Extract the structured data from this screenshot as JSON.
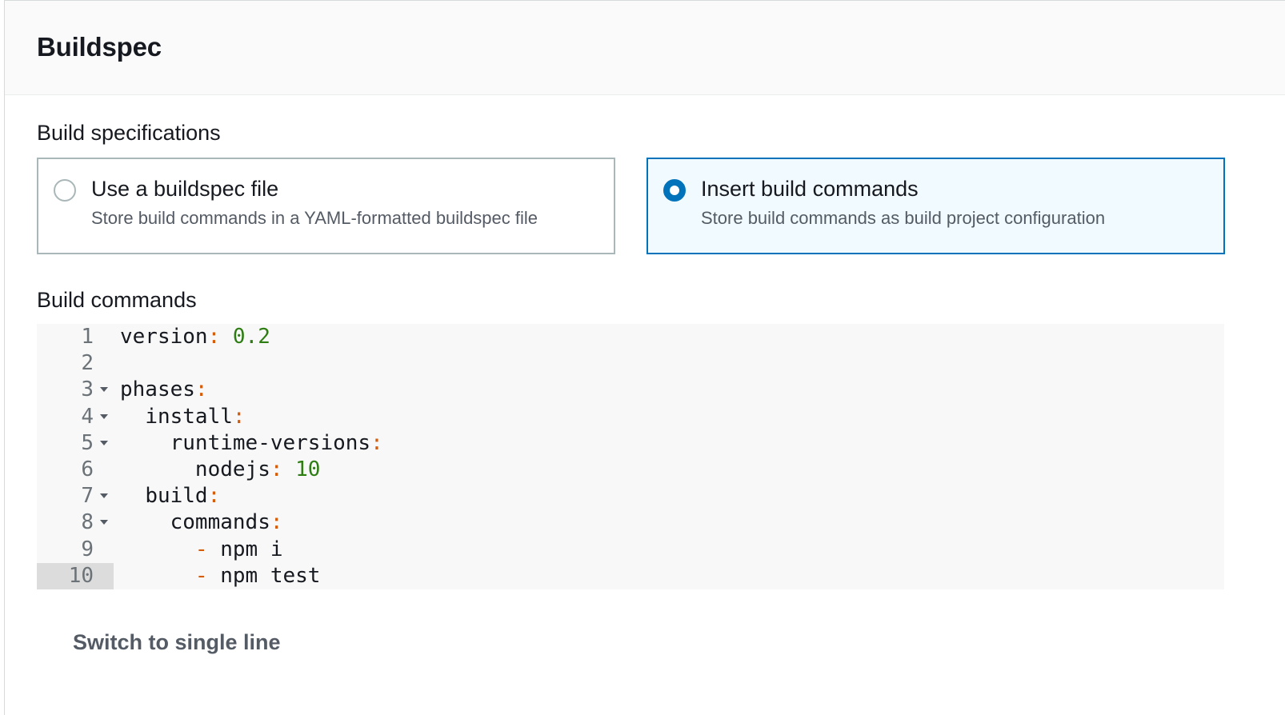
{
  "panel": {
    "title": "Buildspec"
  },
  "build_specifications": {
    "label": "Build specifications",
    "options": [
      {
        "title": "Use a buildspec file",
        "description": "Store build commands in a YAML-formatted buildspec file",
        "selected": false
      },
      {
        "title": "Insert build commands",
        "description": "Store build commands as build project configuration",
        "selected": true
      }
    ]
  },
  "build_commands": {
    "label": "Build commands",
    "lines": [
      {
        "num": "1",
        "indent": "",
        "key": "version",
        "colon": ":",
        "dash": "",
        "value": " 0.2",
        "value_kind": "num",
        "foldable": false
      },
      {
        "num": "2",
        "indent": "",
        "key": "",
        "colon": "",
        "dash": "",
        "value": "",
        "value_kind": "",
        "foldable": false
      },
      {
        "num": "3",
        "indent": "",
        "key": "phases",
        "colon": ":",
        "dash": "",
        "value": "",
        "value_kind": "",
        "foldable": true
      },
      {
        "num": "4",
        "indent": "  ",
        "key": "install",
        "colon": ":",
        "dash": "",
        "value": "",
        "value_kind": "",
        "foldable": true
      },
      {
        "num": "5",
        "indent": "    ",
        "key": "runtime-versions",
        "colon": ":",
        "dash": "",
        "value": "",
        "value_kind": "",
        "foldable": true
      },
      {
        "num": "6",
        "indent": "      ",
        "key": "nodejs",
        "colon": ":",
        "dash": "",
        "value": " 10",
        "value_kind": "num",
        "foldable": false
      },
      {
        "num": "7",
        "indent": "  ",
        "key": "build",
        "colon": ":",
        "dash": "",
        "value": "",
        "value_kind": "",
        "foldable": true
      },
      {
        "num": "8",
        "indent": "    ",
        "key": "commands",
        "colon": ":",
        "dash": "",
        "value": "",
        "value_kind": "",
        "foldable": true
      },
      {
        "num": "9",
        "indent": "      ",
        "key": "",
        "colon": "",
        "dash": "-",
        "value": " npm i",
        "value_kind": "text",
        "foldable": false
      },
      {
        "num": "10",
        "indent": "      ",
        "key": "",
        "colon": "",
        "dash": "-",
        "value": " npm test",
        "value_kind": "text",
        "foldable": false
      }
    ],
    "active_line": "10"
  },
  "switch_link": {
    "label": "Switch to single line"
  },
  "colors": {
    "accent": "#0073bb",
    "punctuation": "#d45b07",
    "number": "#2e7d12"
  },
  "icons": [
    "radio-unchecked-icon",
    "radio-checked-icon",
    "fold-arrow-icon"
  ]
}
